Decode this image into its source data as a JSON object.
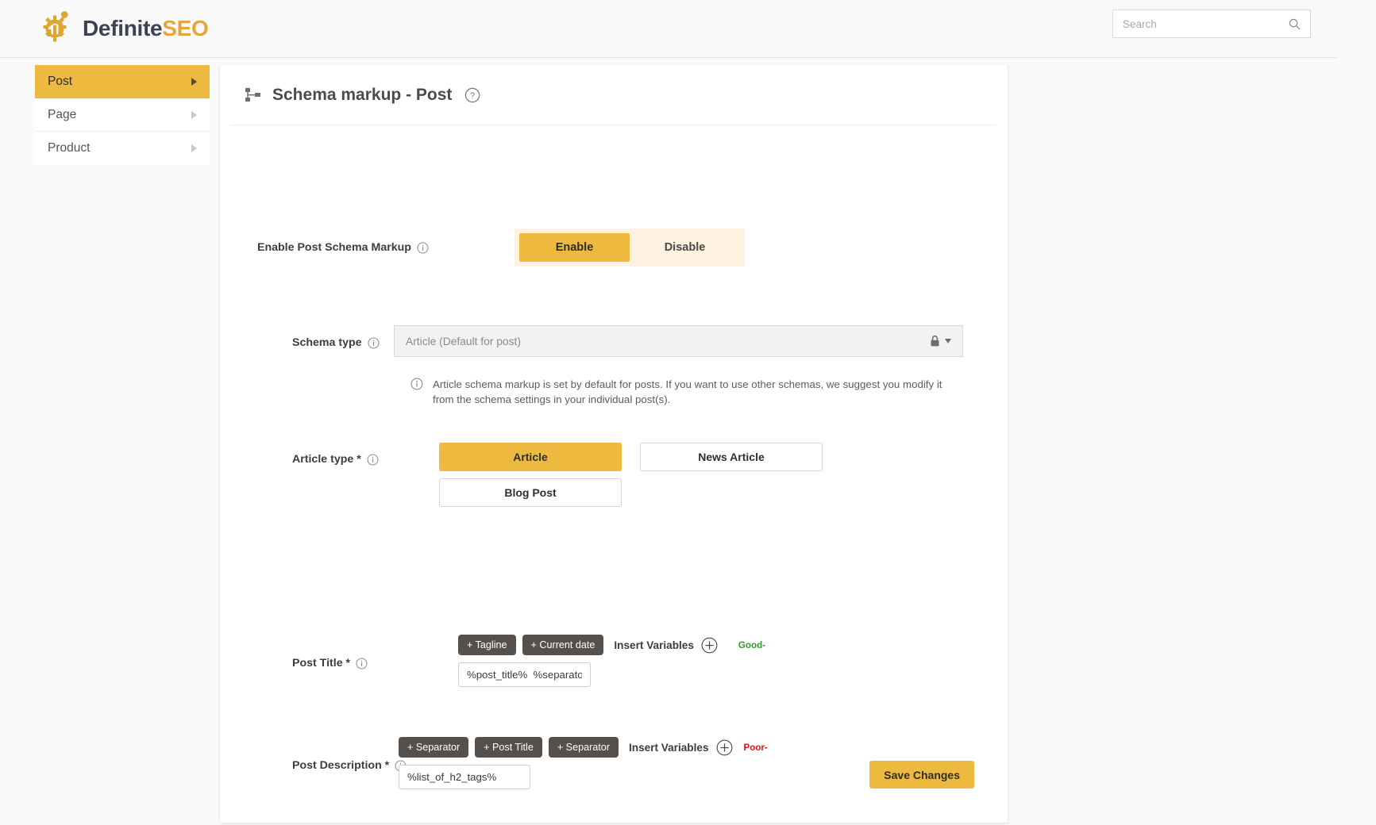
{
  "brand": {
    "name_dark": "Definite",
    "name_accent": "SEO",
    "logo_icon": "gear-chart-logo-icon"
  },
  "search": {
    "placeholder": "Search",
    "value": "",
    "icon": "search-icon"
  },
  "sidebar": {
    "items": [
      {
        "label": "Post",
        "active": true,
        "caret_icon": "chevron-right-icon"
      },
      {
        "label": "Page",
        "active": false,
        "caret_icon": "chevron-right-icon"
      },
      {
        "label": "Product",
        "active": false,
        "caret_icon": "chevron-right-icon"
      }
    ]
  },
  "card": {
    "title": "Schema markup - Post",
    "title_icon": "sitemap-icon",
    "help_icon": "question-circle-icon"
  },
  "enable_row": {
    "label": "Enable Post Schema Markup",
    "info_icon": "info-circle-icon",
    "options": [
      {
        "label": "Enable",
        "selected": true
      },
      {
        "label": "Disable",
        "selected": false
      }
    ]
  },
  "schema_type": {
    "label": "Schema type",
    "info_icon": "info-circle-icon",
    "value": "Article (Default for post)",
    "lock_icon": "lock-icon",
    "caret_icon": "caret-down-icon",
    "note_icon": "info-circle-icon",
    "note": "Article schema markup is set by default for posts. If you want to use other schemas, we suggest you modify it from the schema settings in your individual post(s)."
  },
  "article_type": {
    "label": "Article type *",
    "info_icon": "info-circle-icon",
    "options": [
      {
        "label": "Article",
        "selected": true
      },
      {
        "label": "News Article",
        "selected": false
      },
      {
        "label": "Blog Post",
        "selected": false
      }
    ]
  },
  "post_title": {
    "label": "Post Title *",
    "info_icon": "info-circle-icon",
    "chips": [
      "+ Tagline",
      "+ Current date"
    ],
    "insert_label": "Insert Variables",
    "plus_icon": "plus-circle-icon",
    "score": "Good-",
    "score_color": "#2b9e2b",
    "value": "%post_title%  %separator"
  },
  "post_description": {
    "label": "Post Description *",
    "info_icon": "info-circle-icon",
    "chips": [
      "+ Separator",
      "+ Post Title",
      "+ Separator"
    ],
    "insert_label": "Insert Variables",
    "plus_icon": "plus-circle-icon",
    "score": "Poor-",
    "score_color": "#dd1111",
    "value": "%list_of_h2_tags%"
  },
  "footer": {
    "save_label": "Save Changes"
  },
  "colors": {
    "accent": "#edb93f",
    "chip": "#55504c",
    "good": "#2b9e2b",
    "poor": "#dd1111"
  }
}
